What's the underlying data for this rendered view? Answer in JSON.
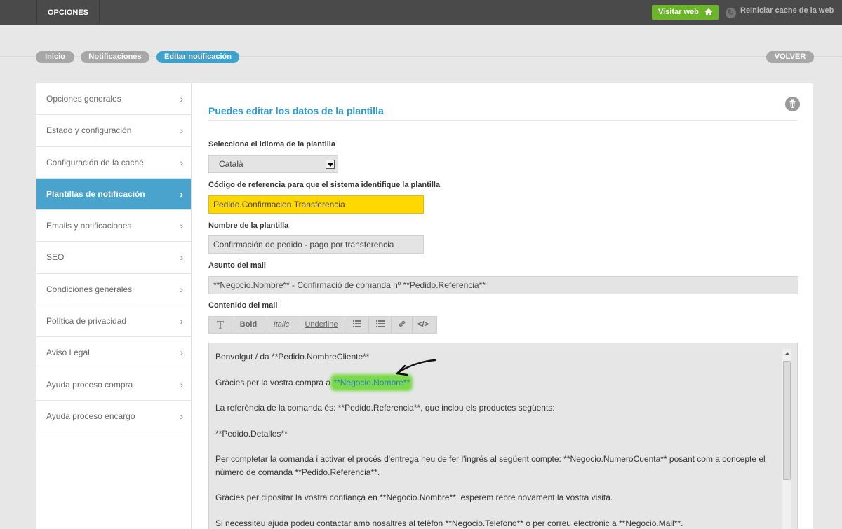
{
  "topbar": {
    "opciones_label": "OPCIONES",
    "visit_label": "Visitar web",
    "reset_label": "Reiniciar cache de la web"
  },
  "breadcrumbs": [
    "Inicio",
    "Notificaciones",
    "Editar notificación"
  ],
  "back_label": "VOLVER",
  "sidebar": {
    "items": [
      {
        "label": "Opciones generales"
      },
      {
        "label": "Estado y configuración"
      },
      {
        "label": "Configuración de la caché"
      },
      {
        "label": "Plantillas de notificación"
      },
      {
        "label": "Emails y notificaciones"
      },
      {
        "label": "SEO"
      },
      {
        "label": "Condiciones generales"
      },
      {
        "label": "Política de privacidad"
      },
      {
        "label": "Aviso Legal"
      },
      {
        "label": "Ayuda proceso compra"
      },
      {
        "label": "Ayuda proceso encargo"
      }
    ],
    "active_index": 3
  },
  "form": {
    "title": "Puedes editar los datos de la plantilla",
    "language_label": "Selecciona el idioma de la plantilla",
    "language_value": "Català",
    "code_label": "Código de referencia para que el sistema identifique la plantilla",
    "code_value": "Pedido.Confirmacion.Transferencia",
    "name_label": "Nombre de la plantilla",
    "name_value": "Confirmación de pedido - pago por transferencia",
    "subject_label": "Asunto del mail",
    "subject_value": "**Negocio.Nombre** - Confirmació de comanda nº **Pedido.Referencia**",
    "content_label": "Contenido del mail"
  },
  "toolbar": {
    "text_icon": "T",
    "bold": "Bold",
    "italic": "Italic",
    "underline": "Underline",
    "code": "</>"
  },
  "editor": {
    "greeting": "Benvolgut / da **Pedido.NombreCliente**",
    "thanks_prefix": "Gràcies per la vostra compra a ",
    "thanks_highlight": "**Negocio.Nombre**",
    "reference": "La referència de la comanda és: **Pedido.Referencia**, que inclou els productes següents:",
    "details": "**Pedido.Detalles**",
    "payment": "Per completar la comanda i activar el procés d'entrega heu de fer l'ingrés al següent compte: **Negocio.NumeroCuenta** posant com a concepte el número de comanda **Pedido.Referencia**.",
    "trust": "Gràcies per dipositar la vostra confiança en **Negocio.Nombre**, esperem rebre novament la vostra visita.",
    "help": "Si necessiteu ajuda podeu contactar amb nosaltres al telèfon **Negocio.Telefono** o per correu electrònic a **Negocio.Mail**."
  },
  "colors": {
    "accent": "#3ea2cf",
    "visit_green": "#6bb528",
    "highlight_field": "#ffd800",
    "annotation_green": "#7bd94a"
  }
}
